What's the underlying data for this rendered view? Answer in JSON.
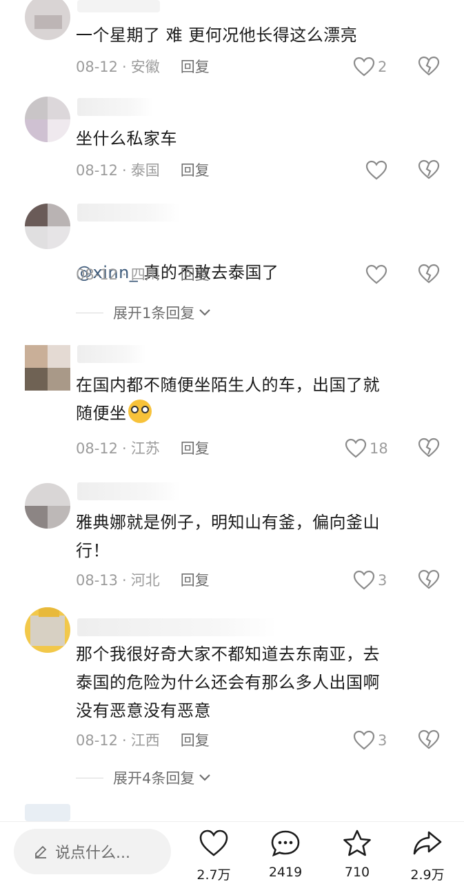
{
  "comments": [
    {
      "text": "一个星期了 难 更何况他长得这么漂亮",
      "date": "08-12",
      "region": "安徽",
      "reply": "回复",
      "likes": "2"
    },
    {
      "text": "坐什么私家车",
      "date": "08-12",
      "region": "泰国",
      "reply": "回复",
      "likes": ""
    },
    {
      "mention": "@xinn_",
      "text": " 真的不敢去泰国了",
      "date": "08-12",
      "region": "四川",
      "reply": "回复",
      "likes": "",
      "expand": "展开1条回复"
    },
    {
      "text": "在国内都不随便坐陌生人的车，出国了就\n随便坐",
      "date": "08-12",
      "region": "江苏",
      "reply": "回复",
      "likes": "18"
    },
    {
      "text": "雅典娜就是例子，明知山有釜，偏向釜山\n行！",
      "date": "08-13",
      "region": "河北",
      "reply": "回复",
      "likes": "3"
    },
    {
      "text": "那个我很好奇大家不都知道去东南亚，去\n泰国的危险为什么还会有那么多人出国啊\n没有恶意没有恶意",
      "date": "08-12",
      "region": "江西",
      "reply": "回复",
      "likes": "3",
      "expand": "展开4条回复"
    }
  ],
  "meta_separator": "·",
  "bottom_bar": {
    "input_placeholder": "说点什么...",
    "like_count": "2.7万",
    "comment_count": "2419",
    "favorite_count": "710",
    "share_count": "2.9万"
  }
}
